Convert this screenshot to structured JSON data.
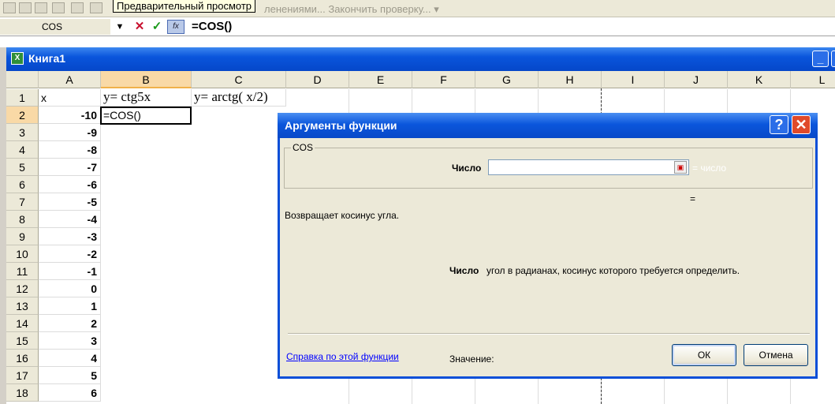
{
  "toolbar": {
    "tooltip": "Предварительный просмотр",
    "partial_text": "ленениями... Закончить проверку...",
    "dropdown_glyph": "▾"
  },
  "formula_bar": {
    "name_box": "COS",
    "name_dropdown": "▼",
    "cancel_glyph": "✕",
    "enter_glyph": "✓",
    "fx_label": "fx",
    "formula": "=COS()"
  },
  "workbook": {
    "title": "Книга1",
    "icon_glyph": "X",
    "minimize_glyph": "_",
    "restore_glyph": "□"
  },
  "columns": [
    "A",
    "B",
    "C",
    "D",
    "E",
    "F",
    "G",
    "H",
    "I",
    "J",
    "K",
    "L"
  ],
  "selected_column": "B",
  "rows": [
    {
      "n": "1",
      "a": "x",
      "b": "y=  ctg5x",
      "c": "y= arctg( x/2)"
    },
    {
      "n": "2",
      "a": "-10",
      "b": "=COS()",
      "c": ""
    },
    {
      "n": "3",
      "a": "-9"
    },
    {
      "n": "4",
      "a": "-8"
    },
    {
      "n": "5",
      "a": "-7"
    },
    {
      "n": "6",
      "a": "-6"
    },
    {
      "n": "7",
      "a": "-5"
    },
    {
      "n": "8",
      "a": "-4"
    },
    {
      "n": "9",
      "a": "-3"
    },
    {
      "n": "10",
      "a": "-2"
    },
    {
      "n": "11",
      "a": "-1"
    },
    {
      "n": "12",
      "a": "0"
    },
    {
      "n": "13",
      "a": "1"
    },
    {
      "n": "14",
      "a": "2"
    },
    {
      "n": "15",
      "a": "3"
    },
    {
      "n": "16",
      "a": "4"
    },
    {
      "n": "17",
      "a": "5"
    },
    {
      "n": "18",
      "a": "6"
    }
  ],
  "active_cell": "=COS()",
  "dialog": {
    "title": "Аргументы функции",
    "help_glyph": "?",
    "close_glyph": "✕",
    "function_name": "COS",
    "arg_label": "Число",
    "arg_value": "",
    "arg_eq": "= число",
    "result_eq": "=",
    "description": "Возвращает косинус угла.",
    "arg_desc_label": "Число",
    "arg_desc_text": "угол в радианах, косинус которого требуется определить.",
    "help_link": "Справка по этой функции",
    "value_label": "Значение:",
    "ok": "ОК",
    "cancel": "Отмена"
  }
}
